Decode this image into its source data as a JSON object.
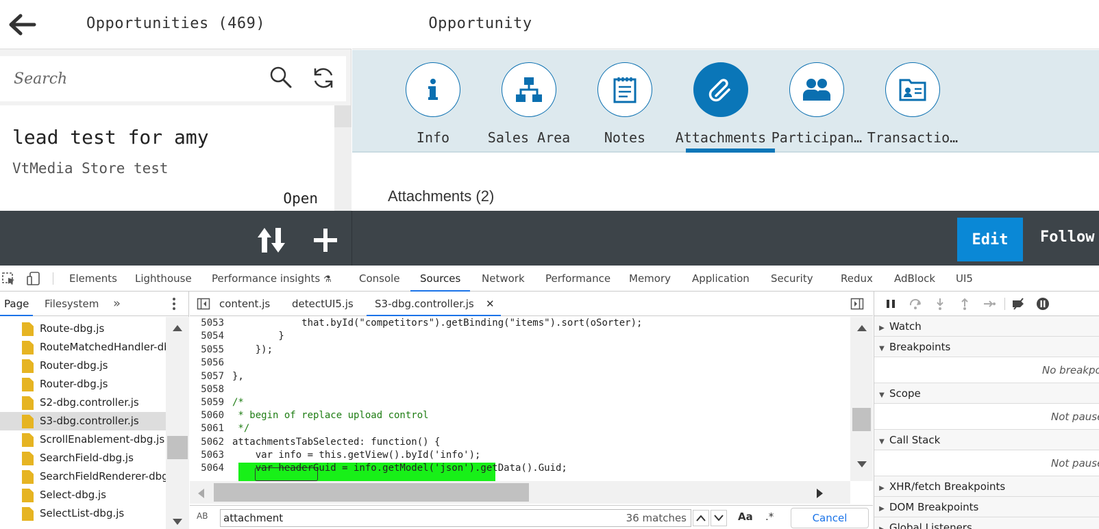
{
  "app": {
    "left_title": "Opportunities (469)",
    "right_title": "Opportunity",
    "search": {
      "placeholder": "Search"
    },
    "list_item": {
      "title": "lead test for amy",
      "subtitle": "VtMedia Store test",
      "status": "Open"
    },
    "tabs": [
      {
        "label": "Info",
        "icon": "info-icon"
      },
      {
        "label": "Sales Area",
        "icon": "hierarchy-icon"
      },
      {
        "label": "Notes",
        "icon": "notes-icon"
      },
      {
        "label": "Attachments",
        "icon": "paperclip-icon",
        "selected": true
      },
      {
        "label": "Participan…",
        "icon": "people-icon"
      },
      {
        "label": "Transactio…",
        "icon": "card-icon"
      }
    ],
    "section_title": "Attachments (2)",
    "footer": {
      "edit_label": "Edit",
      "follow_label": "Follow"
    },
    "colors": {
      "accent": "#0a76b8",
      "footer": "#3d4449",
      "edit": "#0a88d6",
      "highlight": "#18f018"
    }
  },
  "devtools": {
    "tabs": [
      "Elements",
      "Lighthouse",
      "Performance insights",
      "Console",
      "Sources",
      "Network",
      "Performance",
      "Memory",
      "Application",
      "Security",
      "Redux",
      "AdBlock",
      "UI5"
    ],
    "active_tab": "Sources",
    "nav_tabs": [
      "Page",
      "Filesystem"
    ],
    "files": [
      "Route-dbg.js",
      "RouteMatchedHandler-dbg.js",
      "Router-dbg.js",
      "Router-dbg.js",
      "S2-dbg.controller.js",
      "S3-dbg.controller.js",
      "ScrollEnablement-dbg.js",
      "SearchField-dbg.js",
      "SearchFieldRenderer-dbg.js",
      "Select-dbg.js",
      "SelectList-dbg.js"
    ],
    "editor_tabs": [
      "content.js",
      "detectUI5.js",
      "S3-dbg.controller.js"
    ],
    "close_glyph": "✕",
    "code_lines": [
      {
        "n": "5053",
        "text": "            that.byId(\"competitors\").getBinding(\"items\").sort(oSorter);"
      },
      {
        "n": "5054",
        "text": "        }"
      },
      {
        "n": "5055",
        "text": "    });"
      },
      {
        "n": "5056",
        "text": ""
      },
      {
        "n": "5057",
        "text": "},"
      },
      {
        "n": "5058",
        "text": ""
      },
      {
        "n": "5059",
        "text": "/*"
      },
      {
        "n": "5060",
        "text": " * begin of replace upload control"
      },
      {
        "n": "5061",
        "text": " */"
      },
      {
        "n": "5062",
        "text": "attachmentsTabSelected: function() {"
      },
      {
        "n": "5063",
        "text": "    var info = this.getView().byId('info');"
      },
      {
        "n": "5064",
        "text": "    var headerGuid = info.getModel('json').getData().Guid;"
      }
    ],
    "find": {
      "value": "attachment",
      "count": "36 matches",
      "case_label": "Aa",
      "regex_label": ".*",
      "cancel_label": "Cancel",
      "ab_label": "AB"
    },
    "debug_sections": [
      {
        "label": "Watch",
        "expanded": false
      },
      {
        "label": "Breakpoints",
        "expanded": true,
        "body": "No breakpoints"
      },
      {
        "label": "Scope",
        "expanded": true,
        "body": "Not paused"
      },
      {
        "label": "Call Stack",
        "expanded": true,
        "body": "Not paused"
      },
      {
        "label": "XHR/fetch Breakpoints",
        "expanded": false
      },
      {
        "label": "DOM Breakpoints",
        "expanded": false
      },
      {
        "label": "Global Listeners",
        "expanded": false
      }
    ]
  }
}
